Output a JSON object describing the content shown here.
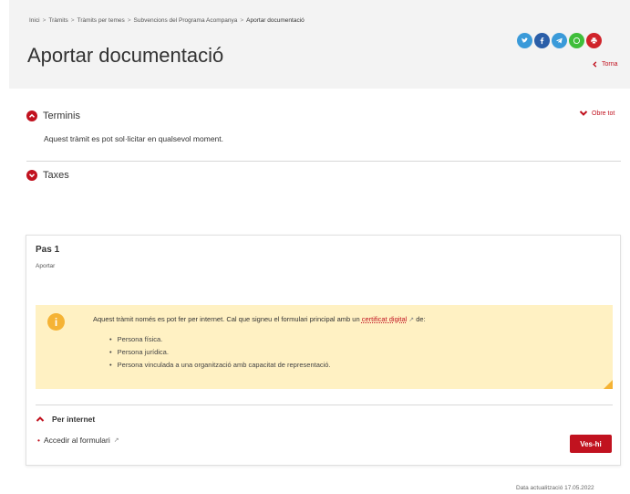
{
  "breadcrumb": {
    "items": [
      "Inici",
      "Tràmits",
      "Tràmits per temes",
      "Subvencions del Programa Acompanya"
    ],
    "current": "Aportar documentació",
    "separator": ">"
  },
  "page": {
    "title": "Aportar documentació"
  },
  "share": {
    "icons": [
      "twitter-icon",
      "facebook-icon",
      "telegram-icon",
      "whatsapp-icon",
      "print-icon"
    ]
  },
  "back": {
    "label": "Torna"
  },
  "accordion": {
    "open_all_label": "Obre tot",
    "sections": [
      {
        "title": "Terminis",
        "expanded": true,
        "body": "Aquest tràmit es pot sol·licitar en qualsevol moment."
      },
      {
        "title": "Taxes",
        "expanded": false
      }
    ]
  },
  "step": {
    "title": "Pas 1",
    "subtitle": "Aportar",
    "notice": {
      "text_before": "Aquest tràmit només es pot fer per internet. Cal que signeu el formulari principal amb un ",
      "link": "certificat digital",
      "text_after": " de:",
      "items": [
        "Persona física.",
        "Persona jurídica.",
        "Persona vinculada a una organització amb capacitat de representació."
      ]
    },
    "channel": {
      "title": "Per internet",
      "link_label": "Accedir al formulari",
      "button_label": "Ves-hi"
    }
  },
  "footer": {
    "date": "Data actualització 17.05.2022"
  },
  "colors": {
    "accent": "#c1121f",
    "notice_bg": "#fff1c3",
    "header_bg": "#f3f3f3",
    "info": "#f5b335"
  }
}
